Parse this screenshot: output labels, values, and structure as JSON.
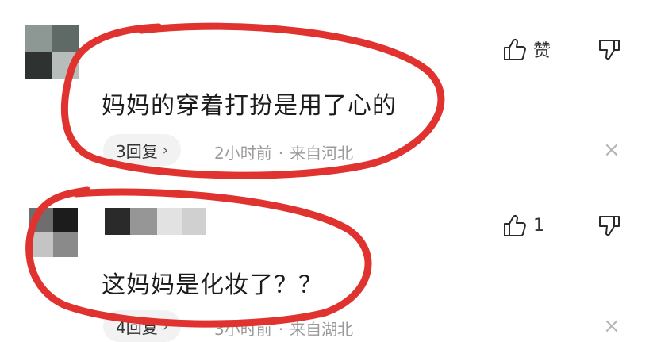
{
  "comments": [
    {
      "text": "妈妈的穿着打扮是用了心的",
      "reply_label": "3回复",
      "time": "2小时前",
      "separator": "·",
      "location": "来自河北",
      "like_label": "赞",
      "like_icon": "thumbs-up-icon",
      "dislike_icon": "thumbs-down-icon",
      "close_glyph": "×"
    },
    {
      "text": "这妈妈是化妆了？？",
      "reply_label": "4回复",
      "time": "3小时前",
      "separator": "·",
      "location": "来自湖北",
      "like_label": "1",
      "like_icon": "thumbs-up-icon",
      "dislike_icon": "thumbs-down-icon",
      "close_glyph": "×"
    }
  ],
  "colors": {
    "highlight": "#e0322f",
    "chip_bg": "#f2f2f2",
    "meta_text": "#9a9a9a"
  }
}
